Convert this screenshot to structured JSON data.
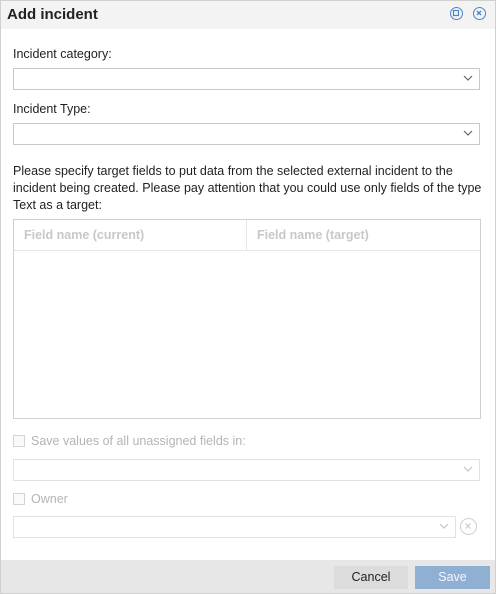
{
  "dialog": {
    "title": "Add incident",
    "header_icons": [
      "maximize-icon",
      "close-icon"
    ]
  },
  "form": {
    "incident_category_label": "Incident category:",
    "incident_category_value": "",
    "incident_type_label": "Incident Type:",
    "incident_type_value": "",
    "description": "Please specify target fields to put data from the selected external incident to the incident being created. Please pay attention that you could use only fields of the type Text as a target:",
    "grid": {
      "columns": [
        "Field name (current)",
        "Field name (target)"
      ],
      "rows": []
    },
    "save_unassigned_label": "Save values of all unassigned fields in:",
    "save_unassigned_checked": false,
    "save_unassigned_value": "",
    "owner_label": "Owner",
    "owner_checked": false,
    "owner_value": ""
  },
  "footer": {
    "cancel_label": "Cancel",
    "save_label": "Save"
  },
  "colors": {
    "accent": "#4a86c8",
    "save_button_disabled": "#8fb0d3",
    "titlebar": "#f3f3f3",
    "footer": "#e7e7e7"
  }
}
